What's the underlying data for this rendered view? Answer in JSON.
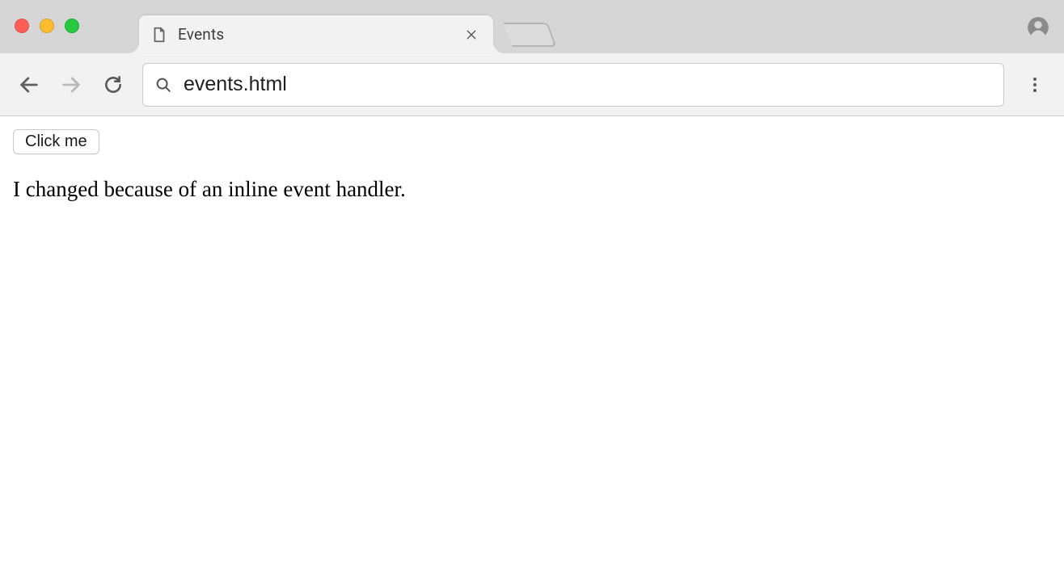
{
  "tab": {
    "title": "Events"
  },
  "toolbar": {
    "url_value": "events.html"
  },
  "page": {
    "button_label": "Click me",
    "paragraph": "I changed because of an inline event handler."
  }
}
